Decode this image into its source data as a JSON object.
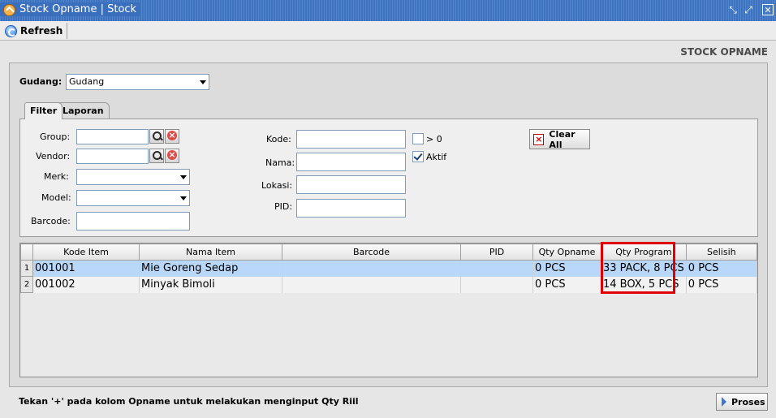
{
  "window": {
    "title": "Stock Opname | Stock"
  },
  "toolbar": {
    "refresh_label": "Refresh"
  },
  "page": {
    "heading": "STOCK OPNAME"
  },
  "gudang": {
    "label": "Gudang:",
    "value": "Gudang"
  },
  "tabs": [
    {
      "label": "Filter",
      "active": true
    },
    {
      "label": "Laporan",
      "active": false
    }
  ],
  "filter": {
    "group_label": "Group:",
    "vendor_label": "Vendor:",
    "merk_label": "Merk:",
    "model_label": "Model:",
    "barcode_label": "Barcode:",
    "kode_label": "Kode:",
    "nama_label": "Nama:",
    "lokasi_label": "Lokasi:",
    "pid_label": "PID:",
    "gt0_label": "> 0",
    "gt0_checked": false,
    "aktif_label": "Aktif",
    "aktif_checked": true,
    "clear_all_label": "Clear All"
  },
  "table": {
    "columns": [
      "Kode Item",
      "Nama Item",
      "Barcode",
      "PID",
      "Qty Opname",
      "Qty Program",
      "Selisih"
    ],
    "rows": [
      {
        "num": "1",
        "kode": "001001",
        "nama": "Mie Goreng Sedap",
        "barcode": "",
        "pid": "",
        "qty_opname": "0 PCS",
        "qty_program": "33 PACK, 8 PCS",
        "selisih": "0 PCS",
        "selected": true
      },
      {
        "num": "2",
        "kode": "001002",
        "nama": "Minyak Bimoli",
        "barcode": "",
        "pid": "",
        "qty_opname": "0 PCS",
        "qty_program": "14 BOX, 5 PCS",
        "selisih": "0 PCS",
        "selected": false
      }
    ]
  },
  "footer": {
    "hint": "Tekan '+' pada kolom Opname untuk melakukan menginput Qty Riil",
    "proses_label": "Proses"
  },
  "colors": {
    "titlebar": "#3d74c2",
    "selected_row": "#b9d7f8",
    "highlight": "#e00000"
  }
}
